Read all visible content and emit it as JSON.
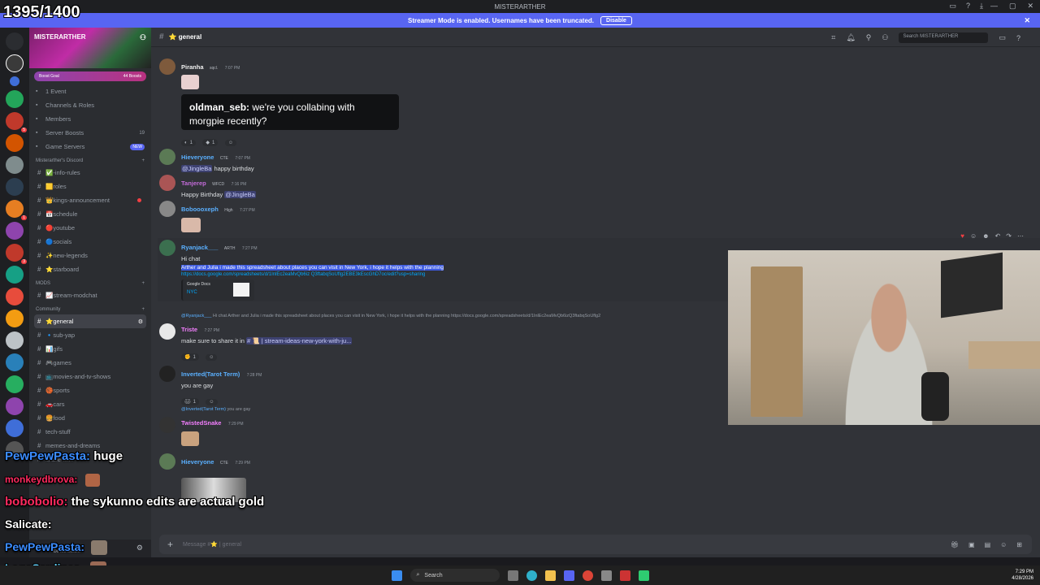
{
  "counter": "1395/1400",
  "titlebar": {
    "title": "MISTERARTHER"
  },
  "banner": {
    "text": "Streamer Mode is enabled. Usernames have been truncated.",
    "button": "Disable"
  },
  "server": {
    "name": "MISTERARTHER",
    "boost_label": "Boost Goal",
    "boost_count": "44 Boosts",
    "menu": [
      {
        "icon": "calendar-icon",
        "label": "1 Event",
        "right": ""
      },
      {
        "icon": "channels-icon",
        "label": "Channels & Roles",
        "right": ""
      },
      {
        "icon": "members-icon",
        "label": "Members",
        "right": ""
      },
      {
        "icon": "boost-icon",
        "label": "Server Boosts",
        "right": "19"
      },
      {
        "icon": "game-icon",
        "label": "Game Servers",
        "right": "NEW"
      }
    ],
    "categories": [
      {
        "name": "Misterarther's Discord",
        "channels": [
          "✅-info-rules",
          "🟨roles",
          "👑kings-announcement",
          "📅schedule",
          "🔴youtube",
          "🔵socials",
          "✨new-legends",
          "⭐starboard"
        ]
      },
      {
        "name": "MODS",
        "channels": [
          "📈stream-modchat"
        ]
      },
      {
        "name": "Community",
        "channels": [
          "⭐general",
          "🔹sub-yap",
          "📊gifs",
          "🎮games",
          "📺movies-and-tv-shows",
          "🏀sports",
          "🚗cars",
          "🍔food",
          "tech-stuff",
          "memes-and-dreams",
          "share-wi..."
        ]
      }
    ],
    "user_status": "Do Not Disturb"
  },
  "channel": {
    "name": "⭐ general",
    "search_placeholder": "Search MISTERARTHER"
  },
  "messages": {
    "m1": {
      "user": "Piranha",
      "tag": "sqcl.",
      "time": "7:07 PM",
      "quote_user": "oldman_seb:",
      "quote_text": "we're you collabing with morgpie recently?",
      "r1": "1",
      "r2": "1"
    },
    "m2": {
      "user": "Hieveryone",
      "tag": "CTE",
      "time": "7:07 PM",
      "mention": "@JingleBa",
      "text": " happy birthday"
    },
    "m3": {
      "user": "Tanjerep",
      "tag": "WFCD",
      "time": "7:16 PM",
      "text": "Happy Birthday ",
      "mention": "@JingleBa"
    },
    "m4": {
      "user": "Boboooxeph",
      "tag": "High",
      "time": "7:27 PM"
    },
    "m5": {
      "user": "Ryanjack___",
      "tag": "ARTH",
      "time": "7:27 PM",
      "line1": "Hi chat",
      "line2": "Arther and Julia i made this spreadsheet about places you can visit in New York, i hope it helps with the planning",
      "link": "https://docs.google.com/spreadsheets/d/1InlEc2eaMvQb6iz Q3ftabqSoUflg2EBE3kEscGhD7oc/edit?usp=sharing",
      "embed_source": "Google Docs",
      "embed_title": "NYC"
    },
    "m6": {
      "reply_user": "@Ryanjack___",
      "reply_text": "Hi chat Arther and Julia i made this spreadsheet about places you can visit in New York, i hope it helps with the planning https://docs.google.com/spreadsheets/d/1InlEc2eaMvQb6izQ3ftabqSoUflg2",
      "user": "Triste",
      "time": "7:27 PM",
      "text": "make sure to share it in ",
      "channel_link": "# 📜 | stream-ideas-new-york-with-ju...",
      "r1": "1"
    },
    "m7": {
      "user": "Inverted(Tarot Term)",
      "time": "7:28 PM",
      "text": "you are gay",
      "r1": "1"
    },
    "m8": {
      "reply_user": "@Inverted(Tarot Term)",
      "reply_text": "you are gay",
      "user": "TwistedSnake",
      "time": "7:29 PM"
    },
    "m9": {
      "user": "Hieveryone",
      "tag": "CTE",
      "time": "7:29 PM"
    }
  },
  "composer": {
    "placeholder": "Message #⭐ | general"
  },
  "overlay": {
    "chat1_name": "PewPewPasta:",
    "chat1_text": "huge",
    "chat2_name": "monkeydbrova:",
    "chat3_name": "bobobolio:",
    "chat3_text": "the sykunno edits are actual gold",
    "chat4_name": "Salicate:",
    "chat5_name": "PewPewPasta:",
    "chat6_name": "LegoSardines:"
  },
  "taskbar": {
    "search": "Search",
    "time": "7:29 PM",
    "date": "4/28/2026"
  }
}
